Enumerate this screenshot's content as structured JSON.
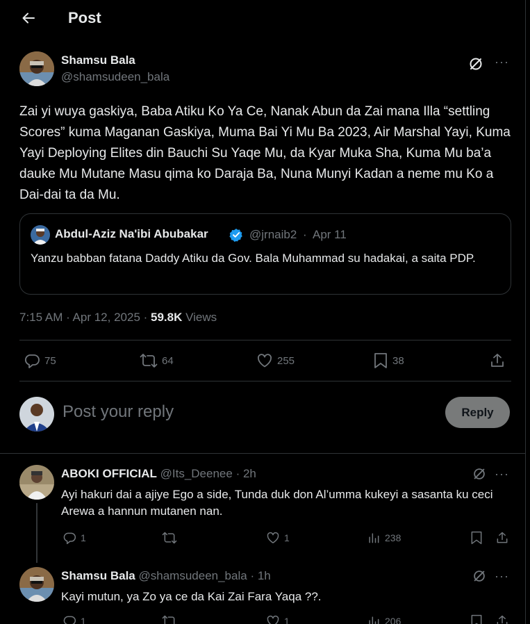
{
  "header": {
    "title": "Post"
  },
  "post": {
    "author_name": "Shamsu Bala",
    "author_handle": "@shamsudeen_bala",
    "text": "Zai yi wuya gaskiya, Baba Atiku Ko Ya Ce, Nanak Abun da Zai mana Illa “settling Scores” kuma Maganan Gaskiya, Muma Bai Yi Mu Ba 2023, Air Marshal Yayi, Kuma Yayi Deploying Elites din Bauchi Su Yaqe Mu, da Kyar Muka Sha, Kuma Mu ba’a dauke Mu Mutane Masu qima ko Daraja Ba, Nuna Munyi Kadan a neme mu Ko a Dai-dai ta da Mu.",
    "quote": {
      "author_name": "Abdul-Aziz Na'ibi Abubakar",
      "author_handle": "@jrnaib2",
      "date": "Apr 11",
      "text": "Yanzu babban fatana Daddy Atiku da Gov. Bala Muhammad su hadakai, a saita PDP."
    },
    "timestamp": "7:15 AM · Apr 12, 2025 ·",
    "views_count": "59.8K",
    "views_label": "Views",
    "stats": {
      "replies": "75",
      "reposts": "64",
      "likes": "255",
      "bookmarks": "38"
    }
  },
  "reply_box": {
    "placeholder": "Post your reply",
    "button": "Reply"
  },
  "replies": [
    {
      "author_name": "ABOKI OFFICIAL",
      "author_handle": "@Its_Deenee",
      "time": "· 2h",
      "text": "Ayi hakuri dai a ajiye Ego a side, Tunda duk don Al’umma kukeyi a sasanta ku ceci Arewa a hannun mutanen nan.",
      "replies": "1",
      "reposts": "",
      "likes": "1",
      "views": "238"
    },
    {
      "author_name": "Shamsu Bala",
      "author_handle": "@shamsudeen_bala",
      "time": "· 1h",
      "text": "Kayi mutun, ya Zo ya ce da Kai Zai Fara Yaqa ??.",
      "replies": "1",
      "reposts": "",
      "likes": "1",
      "views": "206"
    }
  ],
  "colors": {
    "background": "#000000",
    "text": "#e7e9ea",
    "muted": "#71767b",
    "border": "#2f3336",
    "verified": "#1d9bf0"
  }
}
